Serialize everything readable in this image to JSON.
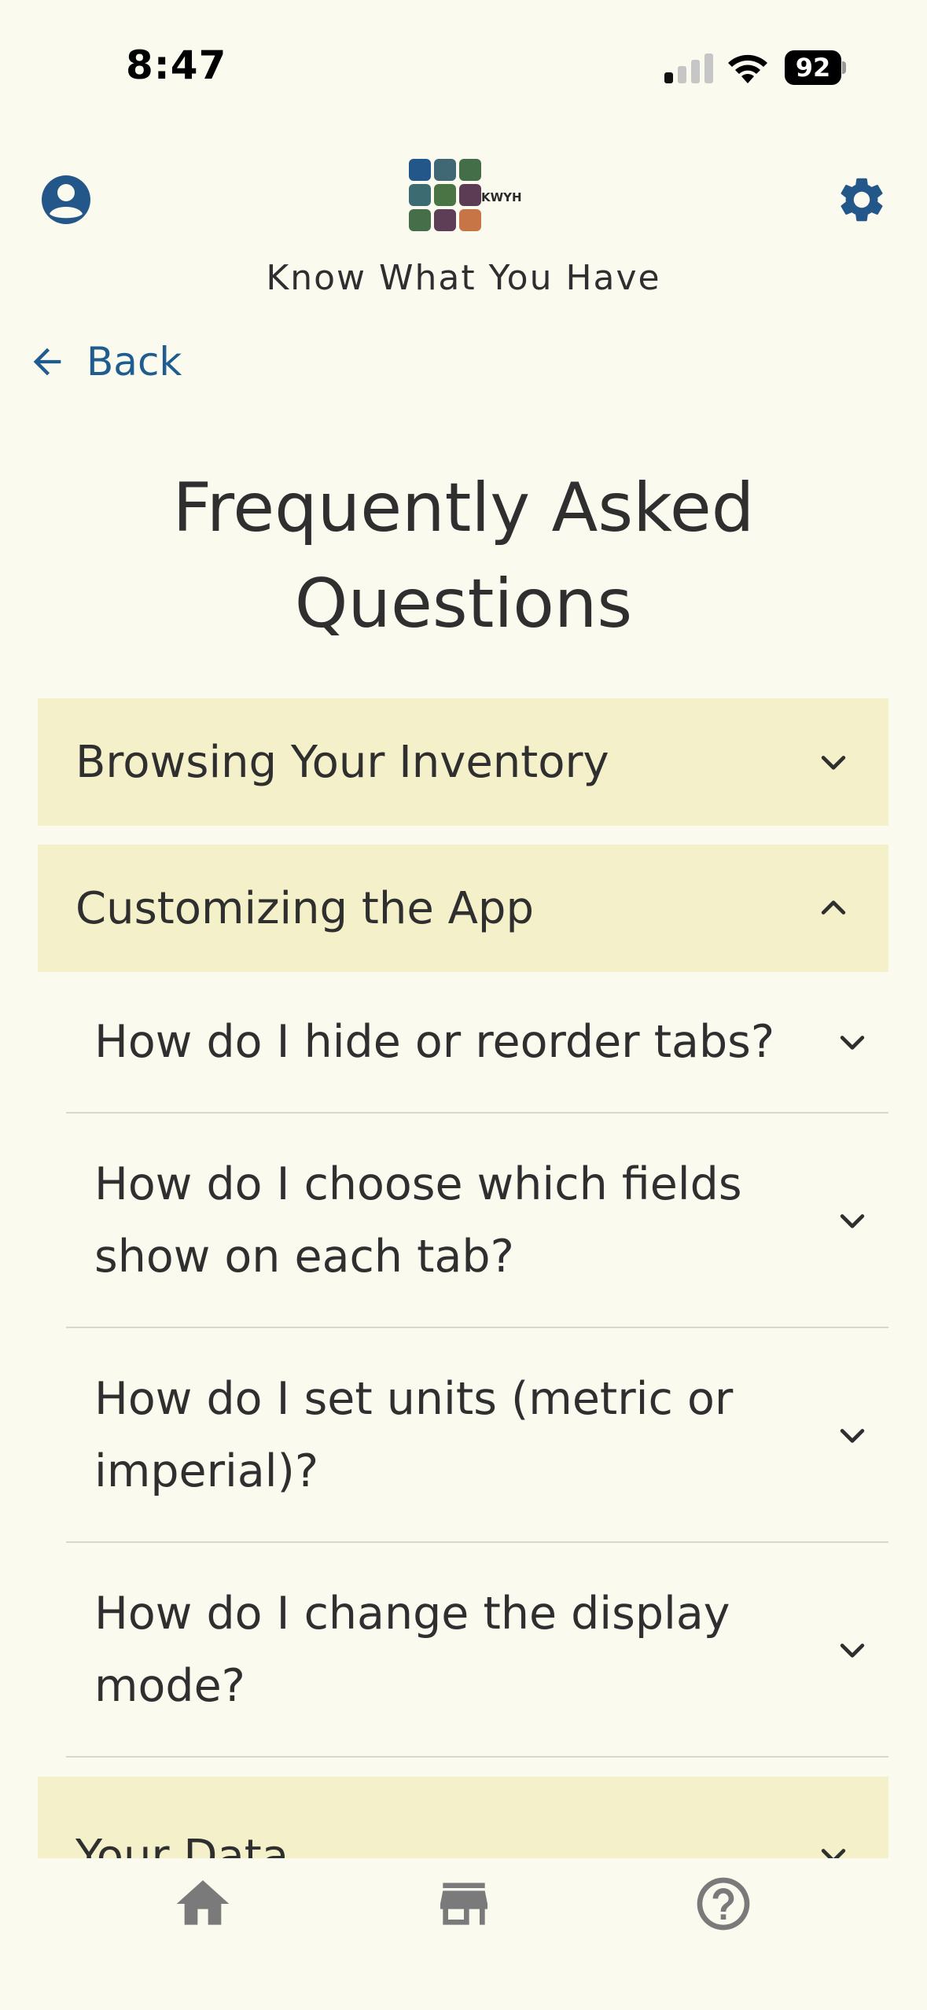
{
  "status_bar": {
    "time": "8:47",
    "battery": "92"
  },
  "header": {
    "logo_text": "KWYH",
    "app_title": "Know What You Have",
    "logo_colors": [
      "#23578a",
      "#3f6874",
      "#436e47",
      "#3d6b72",
      "#4a7444",
      "#5c3c55",
      "#466e48",
      "#5e3d57",
      "#c77446"
    ],
    "profile_icon": "account-circle-icon",
    "settings_icon": "gear-icon"
  },
  "back": {
    "label": "Back"
  },
  "page": {
    "title": "Frequently Asked Questions"
  },
  "faq": {
    "sections": [
      {
        "label": "Browsing Your Inventory",
        "expanded": false
      },
      {
        "label": "Customizing the App",
        "expanded": true,
        "questions": [
          "How do I hide or reorder tabs?",
          "How do I choose which fields show on each tab?",
          "How do I set units (metric or imperial)?",
          "How do I change the display mode?"
        ]
      },
      {
        "label": "Your Data",
        "expanded": false
      }
    ]
  },
  "bottom_nav": {
    "items": [
      {
        "icon": "home-icon"
      },
      {
        "icon": "store-icon"
      },
      {
        "icon": "help-circle-icon"
      }
    ]
  },
  "colors": {
    "background": "#fbfaee",
    "section_bg": "#f4f0c9",
    "accent_blue": "#1f5c8f",
    "nav_gray": "#7a7a7a"
  }
}
